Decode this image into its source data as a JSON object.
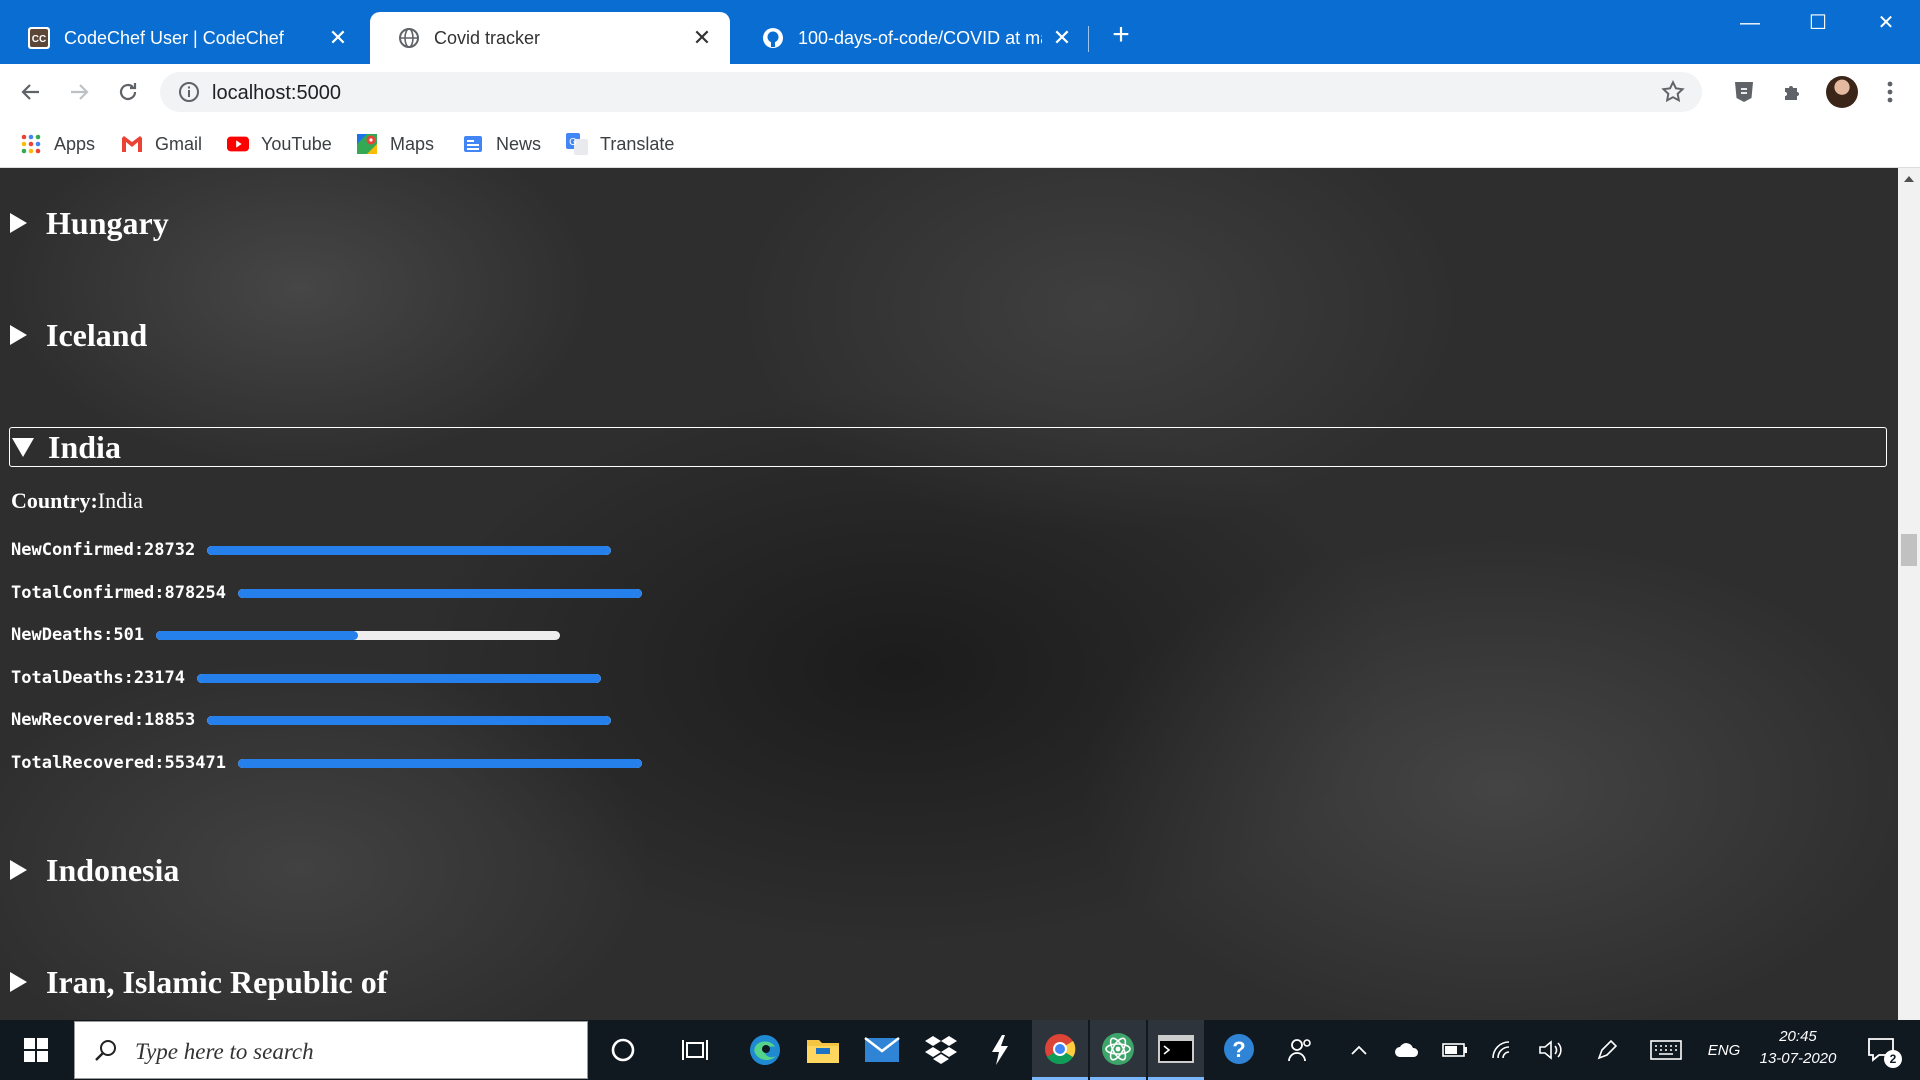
{
  "browser": {
    "tabs": [
      {
        "title": "CodeChef User | CodeChef",
        "favicon": "codechef-icon"
      },
      {
        "title": "Covid tracker",
        "favicon": "globe-icon"
      },
      {
        "title": "100-days-of-code/COVID at mas",
        "favicon": "github-icon"
      }
    ],
    "address": "localhost:5000",
    "bookmarks": [
      "Apps",
      "Gmail",
      "YouTube",
      "Maps",
      "News",
      "Translate"
    ],
    "accent": "#0a6dd1"
  },
  "page": {
    "countries_before": [
      "Hungary",
      "Iceland"
    ],
    "expanded": {
      "name": "India",
      "country_label": "Country:",
      "country_value": "India",
      "stats": [
        {
          "label": "NewConfirmed:28732",
          "level": 1.0
        },
        {
          "label": "TotalConfirmed:878254",
          "level": 1.0
        },
        {
          "label": "NewDeaths:501",
          "level": 0.5
        },
        {
          "label": "TotalDeaths:23174",
          "level": 1.0
        },
        {
          "label": "NewRecovered:18853",
          "level": 1.0
        },
        {
          "label": "TotalRecovered:553471",
          "level": 1.0
        }
      ],
      "bar_color": "#2680eb"
    },
    "countries_after": [
      "Indonesia",
      "Iran, Islamic Republic of"
    ]
  },
  "taskbar": {
    "search_placeholder": "Type here to search",
    "language": "ENG",
    "time": "20:45",
    "date": "13-07-2020",
    "notification_count": "2"
  }
}
